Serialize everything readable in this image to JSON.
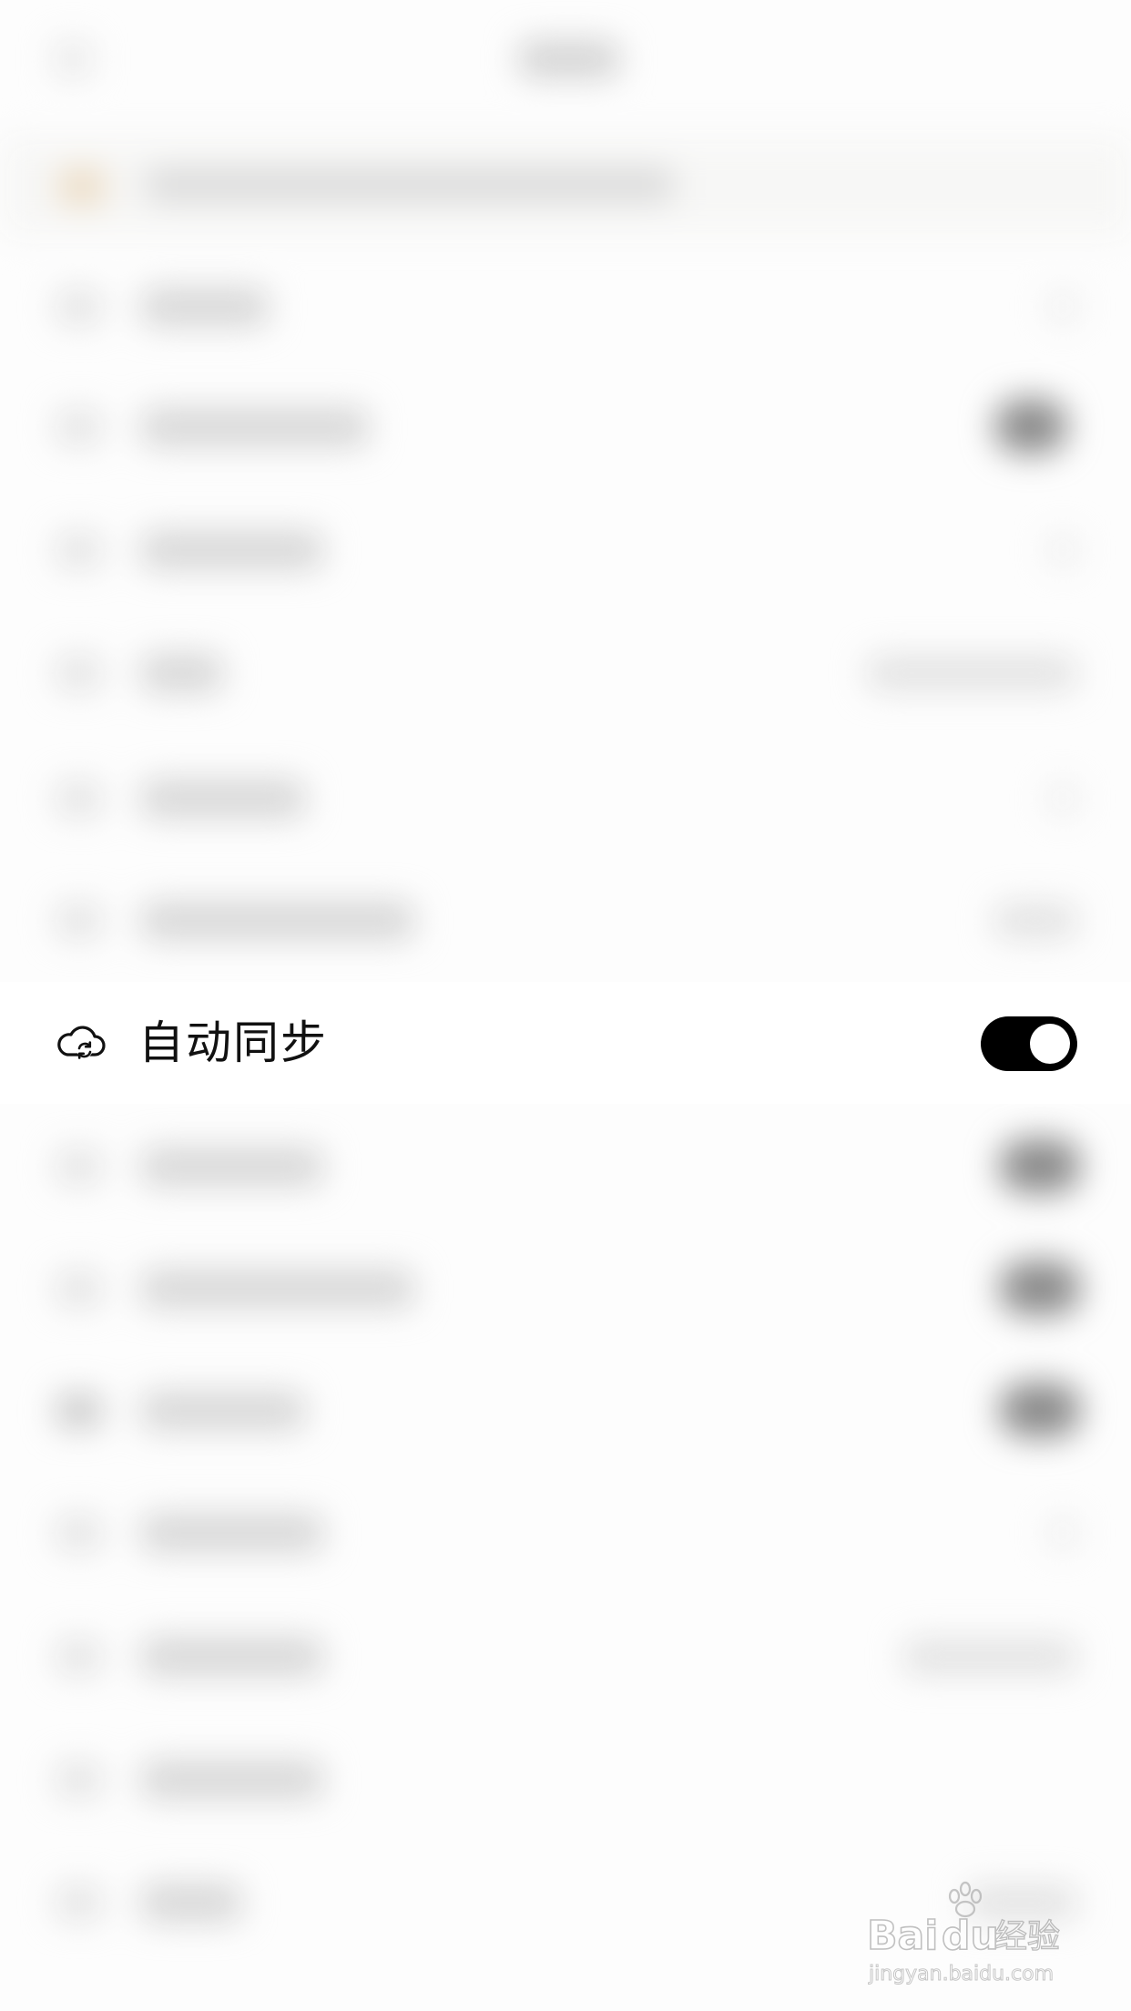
{
  "settings": {
    "focused_item": {
      "label": "自动同步",
      "icon": "cloud-sync-icon",
      "toggle_on": true
    }
  },
  "colors": {
    "toggle_track": "#000000",
    "toggle_knob": "#ffffff",
    "label_text": "#111111",
    "background": "#ffffff"
  },
  "watermark": {
    "logo_text": "Baidu经验",
    "url_text": "jingyan.baidu.com"
  }
}
